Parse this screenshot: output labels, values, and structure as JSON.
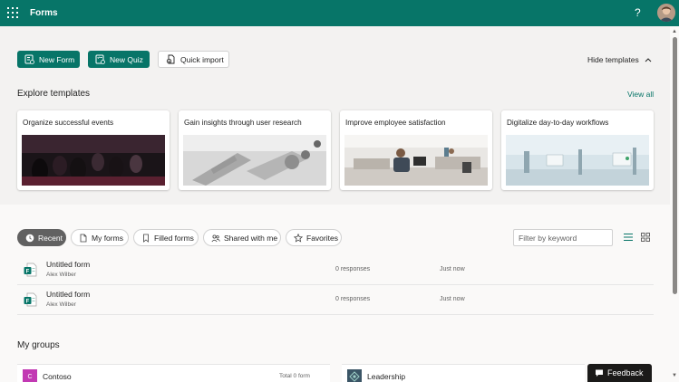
{
  "app": {
    "name": "Forms",
    "help_glyph": "?"
  },
  "toolbar": {
    "new_form": "New Form",
    "new_quiz": "New Quiz",
    "quick_import": "Quick import",
    "hide_templates": "Hide templates"
  },
  "templates": {
    "heading": "Explore templates",
    "view_all": "View all",
    "cards": [
      {
        "title": "Organize successful events"
      },
      {
        "title": "Gain insights through user research"
      },
      {
        "title": "Improve employee satisfaction"
      },
      {
        "title": "Digitalize day-to-day workflows"
      }
    ]
  },
  "filters": {
    "pills": [
      "Recent",
      "My forms",
      "Filled forms",
      "Shared with me",
      "Favorites"
    ],
    "active": "Recent",
    "keyword_placeholder": "Filter by keyword"
  },
  "forms": [
    {
      "name": "Untitled form",
      "owner": "Alex Wilber",
      "responses": "0 responses",
      "modified": "Just now"
    },
    {
      "name": "Untitled form",
      "owner": "Alex Wilber",
      "responses": "0 responses",
      "modified": "Just now"
    }
  ],
  "groups": {
    "heading": "My groups",
    "items": [
      {
        "initial": "C",
        "name": "Contoso",
        "count": "Total 0 form",
        "color": "#c239b3"
      },
      {
        "initial": "",
        "name": "Leadership",
        "count": "",
        "color": "#3b5566"
      }
    ]
  },
  "feedback": {
    "label": "Feedback"
  },
  "theme": {
    "accent": "#077568",
    "active_pill": "#616161"
  }
}
